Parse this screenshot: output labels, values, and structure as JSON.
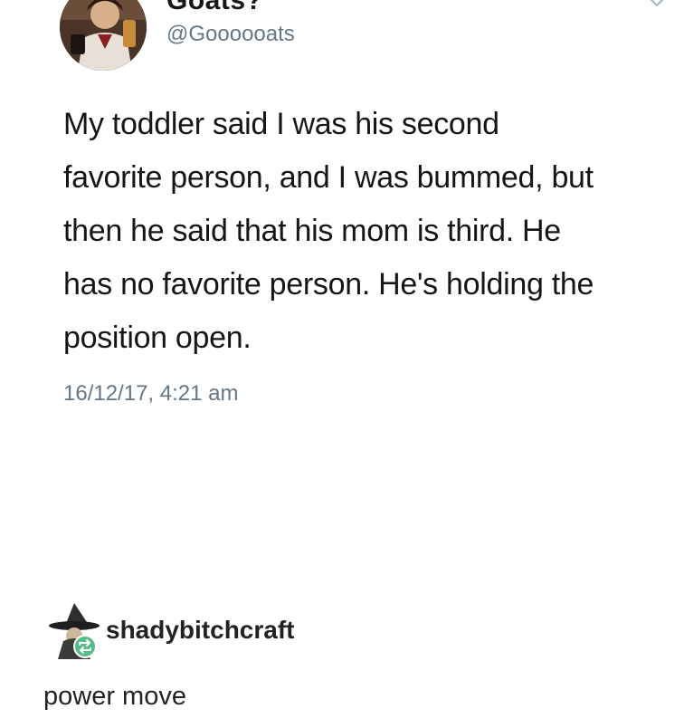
{
  "tweet": {
    "display_name": "Goats?",
    "handle": "@Goooooats",
    "lines": [
      "My toddler said I was his second",
      "favorite person, and I was bummed, but",
      "then he said that his mom is third. He",
      "has no favorite person. He's holding the",
      "position open."
    ],
    "timestamp": "16/12/17, 4:21 am",
    "avatar_icon": "profile-avatar",
    "menu_icon": "chevron-down-icon"
  },
  "reblog": {
    "username": "shadybitchcraft",
    "comment": "power move",
    "avatar_icon": "witch-hat-avatar",
    "badge_icon": "reblog-icon",
    "badge_color": "#56bc8a"
  }
}
